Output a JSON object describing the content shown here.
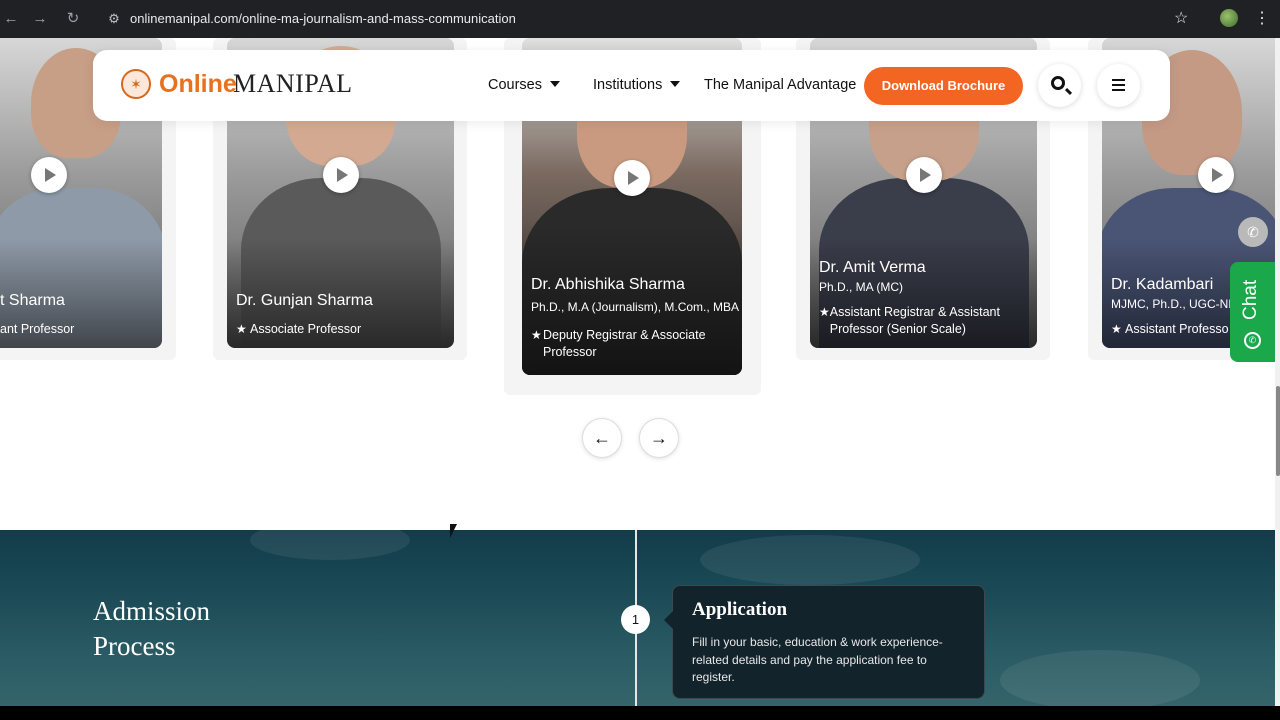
{
  "browser": {
    "url": "onlinemanipal.com/online-ma-journalism-and-mass-communication"
  },
  "header": {
    "logo_online": "Online",
    "logo_manipal": "MANIPAL",
    "nav": [
      {
        "label": "Courses"
      },
      {
        "label": "Institutions"
      },
      {
        "label": "The Manipal Advantage"
      }
    ],
    "download_label": "Download Brochure",
    "colors": {
      "accent": "#f26522",
      "logo_orange": "#e8711e"
    }
  },
  "faculty": [
    {
      "name": "t Sharma",
      "qualification": "",
      "role": "ant Professor"
    },
    {
      "name": "Dr. Gunjan Sharma",
      "qualification": "",
      "role": "Associate Professor"
    },
    {
      "name": "Dr. Abhishika Sharma",
      "qualification": "Ph.D., M.A (Journalism), M.Com., MBA",
      "role": "Deputy Registrar & Associate Professor"
    },
    {
      "name": "Dr. Amit Verma",
      "qualification": "Ph.D., MA (MC)",
      "role": "Assistant Registrar & Assistant Professor (Senior Scale)"
    },
    {
      "name": "Dr. Kadambari",
      "qualification": "MJMC, Ph.D., UGC-NE",
      "role": "Assistant Professo"
    }
  ],
  "carousel": {
    "prev_icon": "arrow-left",
    "next_icon": "arrow-right"
  },
  "side": {
    "chat_label": "Chat",
    "chat_color": "#1aa84b"
  },
  "admission": {
    "title": "Admission Process",
    "steps": [
      {
        "number": "1",
        "title": "Application",
        "description": "Fill in your basic, education & work experience-related details and pay the application fee to register."
      }
    ]
  }
}
